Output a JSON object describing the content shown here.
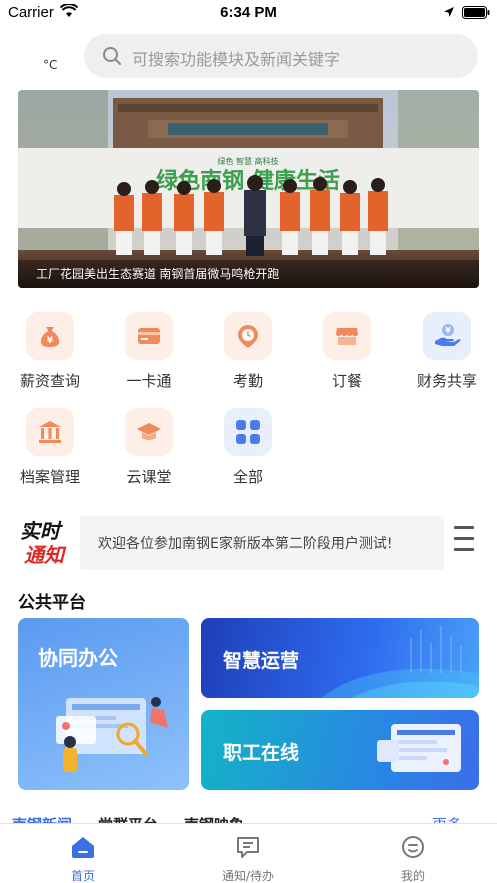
{
  "status_bar": {
    "carrier": "Carrier",
    "time": "6:34 PM"
  },
  "header": {
    "temperature": "°C",
    "search_placeholder": "可搜索功能模块及新闻关键字"
  },
  "banner": {
    "caption": "工厂花园美出生态赛道 南钢首届微马鸣枪开跑",
    "sign_text": "绿色南钢 健康生活",
    "sign_small": "绿色 智慧 高科技"
  },
  "grid": [
    {
      "label": "薪资查询",
      "icon": "money-bag-icon"
    },
    {
      "label": "一卡通",
      "icon": "card-icon"
    },
    {
      "label": "考勤",
      "icon": "clock-pin-icon"
    },
    {
      "label": "订餐",
      "icon": "shop-icon"
    },
    {
      "label": "财务共享",
      "icon": "coin-hand-icon"
    },
    {
      "label": "档案管理",
      "icon": "archive-icon"
    },
    {
      "label": "云课堂",
      "icon": "graduation-cap-icon"
    },
    {
      "label": "全部",
      "icon": "grid-icon"
    }
  ],
  "notice": {
    "logo_top": "实时",
    "logo_bottom": "通知",
    "text": "欢迎各位参加南钢E家新版本第二阶段用户测试!"
  },
  "platform": {
    "title": "公共平台",
    "cards": [
      {
        "title": "协同办公"
      },
      {
        "title": "智慧运营"
      },
      {
        "title": "职工在线"
      }
    ]
  },
  "news_tabs": [
    "南钢新闻",
    "党群平台",
    "南钢映象",
    "更多"
  ],
  "tab_bar": [
    {
      "label": "首页",
      "icon": "home-icon"
    },
    {
      "label": "通知/待办",
      "icon": "message-icon"
    },
    {
      "label": "我的",
      "icon": "user-icon"
    }
  ],
  "colors": {
    "accent": "#3c6fe0",
    "grid_icon_bg": "#fdeee6",
    "grid_icon_fg": "#f08a5d",
    "all_icon_bg": "#e8eefc"
  }
}
